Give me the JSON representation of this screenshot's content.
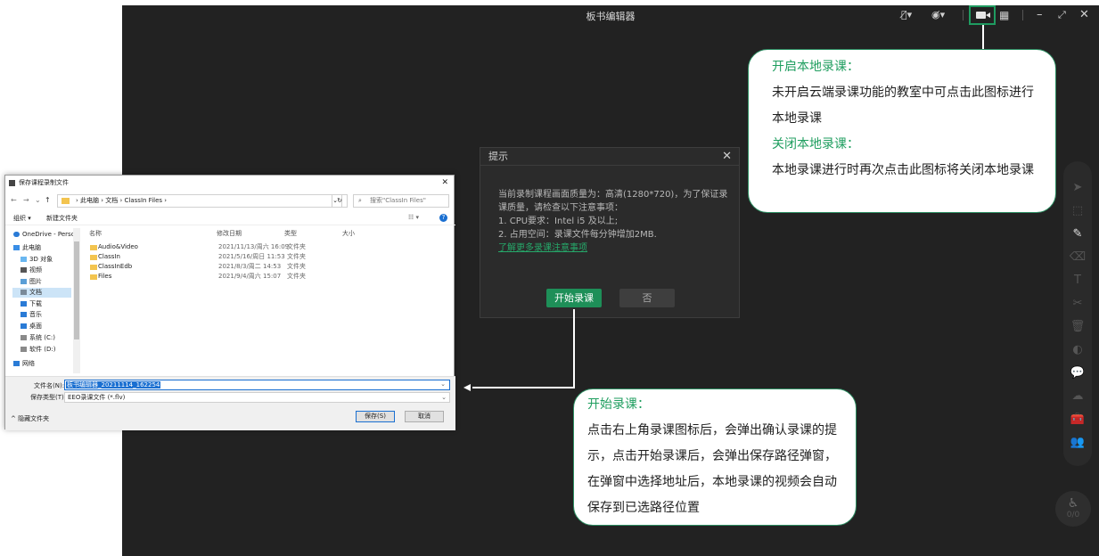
{
  "editor": {
    "title": "板书编辑器",
    "seat_count": "0/0"
  },
  "prompt": {
    "title": "提示",
    "line1": "当前录制课程画面质量为：高清(1280*720)，为了保证录课质量，请检查以下注意事项：",
    "line2": "1. CPU要求：Intel i5 及以上;",
    "line3": "2. 占用空间：录课文件每分钟增加2MB.",
    "link": "了解更多录课注意事项",
    "start_label": "开始录课",
    "no_label": "否"
  },
  "callout_local": {
    "open_heading": "开启本地录课：",
    "open_text": "未开启云端录课功能的教室中可点击此图标进行本地录课",
    "close_heading": "关闭本地录课：",
    "close_text": "本地录课进行时再次点击此图标将关闭本地录课"
  },
  "callout_start": {
    "heading": "开始录课：",
    "text": "点击右上角录课图标后，会弹出确认录课的提示，点击开始录课后，会弹出保存路径弹窗，在弹窗中选择地址后，本地录课的视频会自动保存到已选路径位置"
  },
  "save_dialog": {
    "title": "保存课程录制文件",
    "path": [
      "此电脑",
      "文档",
      "ClassIn Files"
    ],
    "search_placeholder": "搜索\"ClassIn Files\"",
    "organize_label": "组织 ▾",
    "new_folder_label": "新建文件夹",
    "tree": [
      {
        "label": "OneDrive - Perso",
        "icon": "cloud-icon"
      },
      {
        "label": "此电脑",
        "icon": "computer-icon"
      },
      {
        "label": "3D 对象",
        "icon": "cube-icon"
      },
      {
        "label": "视频",
        "icon": "video-icon"
      },
      {
        "label": "图片",
        "icon": "picture-icon"
      },
      {
        "label": "文档",
        "icon": "document-icon",
        "selected": true
      },
      {
        "label": "下载",
        "icon": "download-icon"
      },
      {
        "label": "音乐",
        "icon": "music-icon"
      },
      {
        "label": "桌面",
        "icon": "desktop-icon"
      },
      {
        "label": "系统 (C:)",
        "icon": "drive-icon"
      },
      {
        "label": "软件 (D:)",
        "icon": "drive-icon"
      },
      {
        "label": "网络",
        "icon": "network-icon"
      }
    ],
    "columns": [
      "名称",
      "修改日期",
      "类型",
      "大小"
    ],
    "files": [
      {
        "name": "Audio&Video",
        "date": "2021/11/13/周六 16:09",
        "type": "文件夹"
      },
      {
        "name": "ClassIn",
        "date": "2021/5/16/周日 11:53",
        "type": "文件夹"
      },
      {
        "name": "ClassInEdb",
        "date": "2021/8/3/周二 14:53",
        "type": "文件夹"
      },
      {
        "name": "Files",
        "date": "2021/9/4/周六 15:07",
        "type": "文件夹"
      }
    ],
    "filename_label": "文件名(N):",
    "filename_value": "板书编辑器_20211114_162254",
    "filetype_label": "保存类型(T):",
    "filetype_value": "EEO录课文件 (*.flv)",
    "hide_folders_label": "^ 隐藏文件夹",
    "save_label": "保存(S)",
    "cancel_label": "取消"
  },
  "colors": {
    "accent_green": "#1f9e5f",
    "editor_bg": "#222222",
    "windows_blue": "#1a6fd1"
  }
}
